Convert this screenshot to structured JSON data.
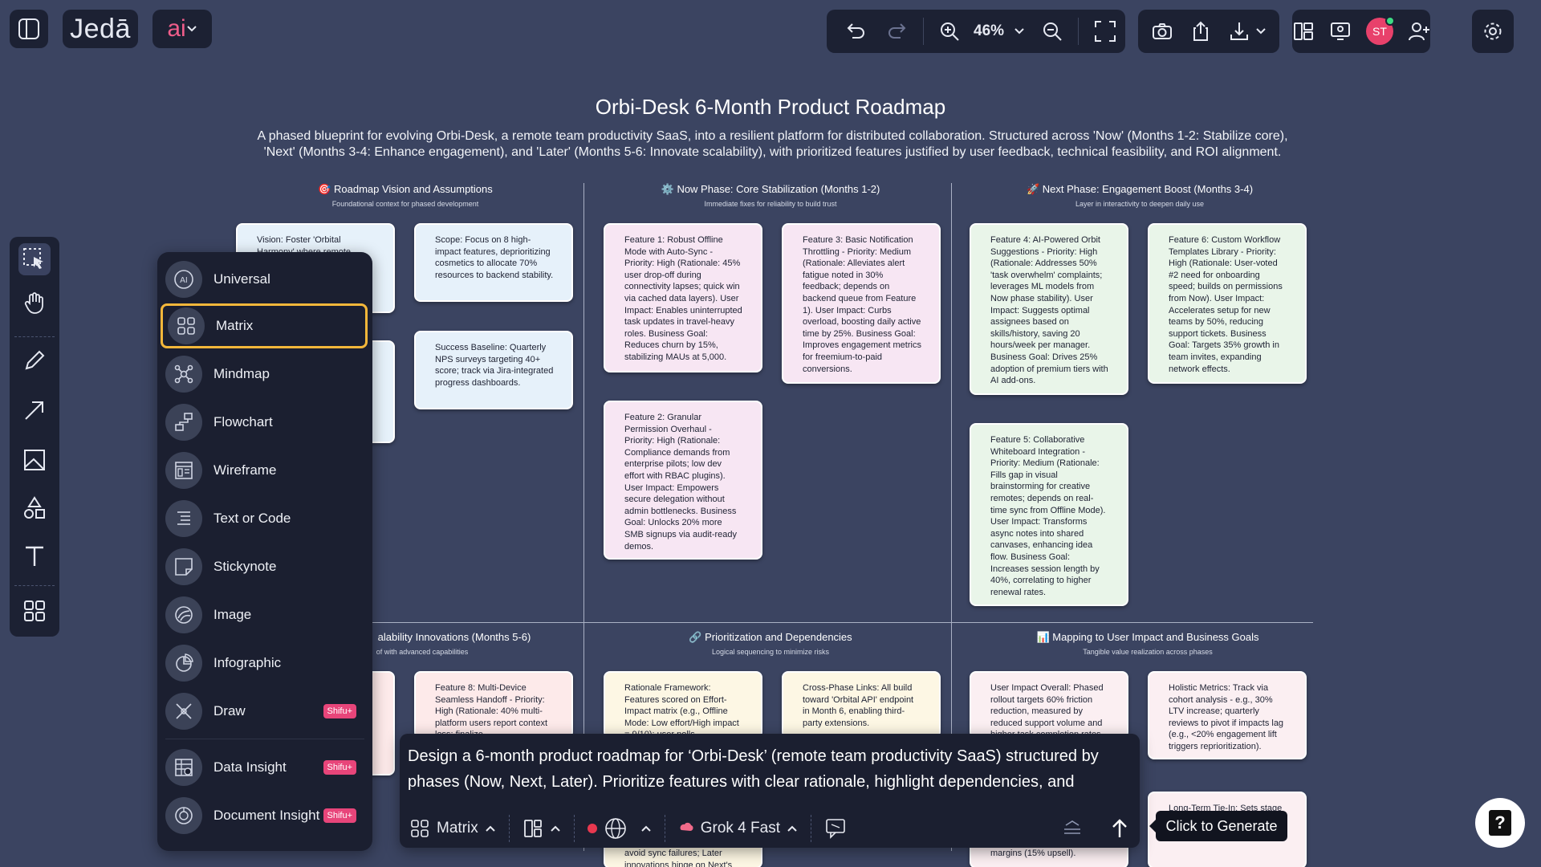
{
  "app": {
    "logo": "Jedā",
    "ai_label": "ai",
    "zoom": "46%",
    "user_initials": "ST",
    "colors": {
      "accent": "#f4b73a",
      "badge": "#e8457a",
      "avatar": "#e8416b",
      "canvas": "#3b4461",
      "panel": "#1b1f30"
    }
  },
  "canvas": {
    "title": "Orbi-Desk 6-Month Product Roadmap",
    "description": "A phased blueprint for evolving Orbi-Desk, a remote team productivity SaaS, into a resilient platform for distributed collaboration. Structured across 'Now' (Months 1-2: Stabilize core), 'Next' (Months 3-4: Enhance engagement), and 'Later' (Months 5-6: Innovate scalability), with prioritized features justified by user feedback, technical feasibility, and ROI alignment.",
    "sections": [
      {
        "title": "🎯 Roadmap Vision and Assumptions",
        "subtitle": "Foundational context for phased development"
      },
      {
        "title": "⚙️ Now Phase: Core Stabilization (Months 1-2)",
        "subtitle": "Immediate fixes for reliability to build trust"
      },
      {
        "title": "🚀 Next Phase: Engagement Boost (Months 3-4)",
        "subtitle": "Layer in interactivity to deepen daily use"
      },
      {
        "title": "alability Innovations (Months 5-6)",
        "subtitle": "of with advanced capabilities"
      },
      {
        "title": "🔗 Prioritization and Dependencies",
        "subtitle": "Logical sequencing to minimize risks"
      },
      {
        "title": "📊 Mapping to User Impact and Business Goals",
        "subtitle": "Tangible value realization across phases"
      }
    ],
    "notes": {
      "vision": "Vision: Foster 'Orbital Harmony' where remote",
      "scope": "Scope: Focus on 8 high-impact features, deprioritizing cosmetics to allocate 70% resources to backend stability.",
      "baseline": "Success Baseline: Quarterly NPS surveys targeting 40+ score; track via Jira-integrated progress dashboards.",
      "f1": "Feature 1: Robust Offline Mode with Auto-Sync - Priority: High (Rationale: 45% user drop-off during connectivity lapses; quick win via cached data layers). User Impact: Enables uninterrupted task updates in travel-heavy roles. Business Goal: Reduces churn by 15%, stabilizing MAUs at 5,000.",
      "f3": "Feature 3: Basic Notification Throttling - Priority: Medium (Rationale: Alleviates alert fatigue noted in 30% feedback; depends on backend queue from Feature 1). User Impact: Curbs overload, boosting daily active time by 25%. Business Goal: Improves engagement metrics for freemium-to-paid conversions.",
      "f2": "Feature 2: Granular Permission Overhaul - Priority: High (Rationale: Compliance demands from enterprise pilots; low dev effort with RBAC plugins). User Impact: Empowers secure delegation without admin bottlenecks. Business Goal: Unlocks 20% more SMB signups via audit-ready demos.",
      "f4": "Feature 4: AI-Powered Orbit Suggestions - Priority: High (Rationale: Addresses 50% 'task overwhelm' complaints; leverages ML models from Now phase stability). User Impact: Suggests optimal assignees based on skills/history, saving 20 hours/week per manager. Business Goal: Drives 25% adoption of premium tiers with AI add-ons.",
      "f6": "Feature 6: Custom Workflow Templates Library - Priority: High (Rationale: User-voted #2 need for onboarding speed; builds on permissions from Now). User Impact: Accelerates setup for new teams by 50%, reducing support tickets. Business Goal: Targets 35% growth in team invites, expanding network effects.",
      "f5": "Feature 5: Collaborative Whiteboard Integration - Priority: Medium (Rationale: Fills gap in visual brainstorming for creative remotes; depends on real-time sync from Offline Mode). User Impact: Transforms async notes into shared canvases, enhancing idea flow. Business Goal: Increases session length by 40%, correlating to higher renewal rates.",
      "f8": "Feature 8: Multi-Device Seamless Handoff - Priority: High (Rationale: 40% multi-platform users report context loss; finalize",
      "rationale": "Rationale Framework: Features scored on Effort-Impact matrix (e.g., Offline Mode: Low effort/High impact = 9/10); user polls",
      "crossphase": "Cross-Phase Links: All build toward 'Orbital API' endpoint in Month 6, enabling third-party extensions.",
      "impact": "User Impact Overall: Phased rollout targets 60% friction reduction, measured by reduced support volume and higher task completion rates",
      "holistic": "Holistic Metrics: Track via cohort analysis - e.g., 30% LTV increase; quarterly reviews to pivot if impacts lag (e.g., <20% engagement lift triggers reprioritization).",
      "longterm": "Long-Term Tie-In: Sets stage users by extending 6-month momentum.",
      "bottom_peek": "avoid sync failures; Later innovations hinge on Next's",
      "margins_peek": "margins (15% upsell)."
    }
  },
  "insert_menu": {
    "items": [
      {
        "label": "Universal",
        "icon": "ai-icon"
      },
      {
        "label": "Matrix",
        "icon": "matrix-grid-icon"
      },
      {
        "label": "Mindmap",
        "icon": "mindmap-icon"
      },
      {
        "label": "Flowchart",
        "icon": "flowchart-icon"
      },
      {
        "label": "Wireframe",
        "icon": "wireframe-icon"
      },
      {
        "label": "Text or Code",
        "icon": "text-code-icon"
      },
      {
        "label": "Stickynote",
        "icon": "stickynote-icon"
      },
      {
        "label": "Image",
        "icon": "image-icon"
      },
      {
        "label": "Infographic",
        "icon": "infographic-icon"
      },
      {
        "label": "Draw",
        "icon": "draw-icon",
        "badge": "Shifu+"
      },
      {
        "label": "Data Insight",
        "icon": "data-insight-icon",
        "badge": "Shifu+"
      },
      {
        "label": "Document Insight",
        "icon": "document-insight-icon",
        "badge": "Shifu+"
      }
    ],
    "selected": "Matrix"
  },
  "prompt": {
    "text": "Design a 6-month product roadmap for ‘Orbi-Desk’ (remote team productivity SaaS) structured by phases (Now, Next, Later). Prioritize features with clear rationale, highlight dependencies, and",
    "mode_label": "Matrix",
    "model_label": "Grok 4 Fast",
    "generate_tooltip": "Click to Generate"
  }
}
